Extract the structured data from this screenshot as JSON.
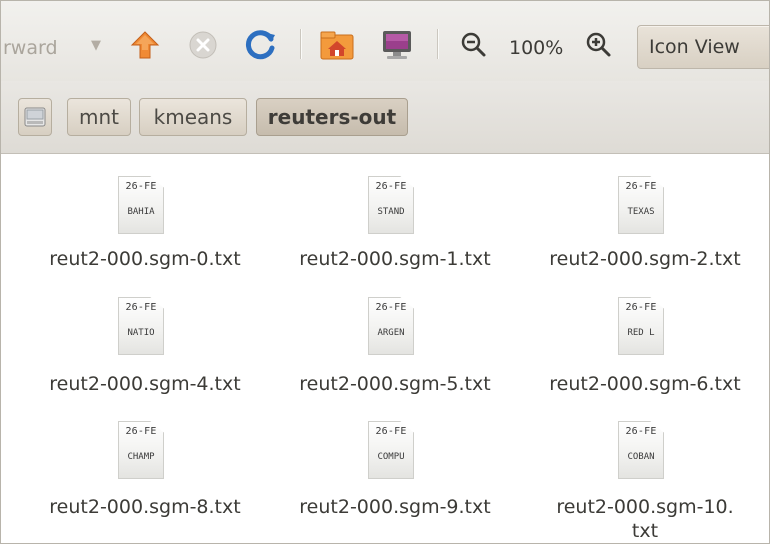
{
  "toolbar": {
    "forward_label": "rward",
    "forward_arrow": "▼",
    "zoom_level": "100%",
    "view_mode": "Icon View",
    "icons": [
      "up-icon",
      "stop-icon",
      "reload-icon",
      "home-folder-icon",
      "computer-icon",
      "zoom-out-icon",
      "zoom-in-icon"
    ]
  },
  "pathbar": {
    "crumbs": [
      "mnt",
      "kmeans",
      "reuters-out"
    ],
    "active": "reuters-out"
  },
  "files": [
    {
      "name": "reut2-000.sgm-0.txt",
      "preview_top": "26-FE",
      "preview_bottom": "BAHIA"
    },
    {
      "name": "reut2-000.sgm-1.txt",
      "preview_top": "26-FE",
      "preview_bottom": "STAND"
    },
    {
      "name": "reut2-000.sgm-2.txt",
      "preview_top": "26-FE",
      "preview_bottom": "TEXAS"
    },
    {
      "name": "reut2-000.sgm-4.txt",
      "preview_top": "26-FE",
      "preview_bottom": "NATIO"
    },
    {
      "name": "reut2-000.sgm-5.txt",
      "preview_top": "26-FE",
      "preview_bottom": "ARGEN"
    },
    {
      "name": "reut2-000.sgm-6.txt",
      "preview_top": "26-FE",
      "preview_bottom": "RED L"
    },
    {
      "name": "reut2-000.sgm-8.txt",
      "preview_top": "26-FE",
      "preview_bottom": "CHAMP"
    },
    {
      "name": "reut2-000.sgm-9.txt",
      "preview_top": "26-FE",
      "preview_bottom": "COMPU"
    },
    {
      "name": "reut2-000.sgm-10.txt",
      "name_line1": "reut2-000.sgm-10.",
      "name_line2": "txt",
      "preview_top": "26-FE",
      "preview_bottom": "COBAN"
    }
  ]
}
